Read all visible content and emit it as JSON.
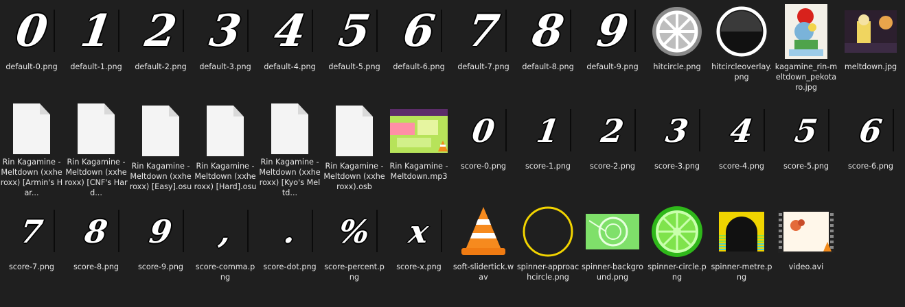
{
  "files": [
    {
      "label": "default-0.png",
      "kind": "digit",
      "glyph": "0"
    },
    {
      "label": "default-1.png",
      "kind": "digit",
      "glyph": "1"
    },
    {
      "label": "default-2.png",
      "kind": "digit",
      "glyph": "2"
    },
    {
      "label": "default-3.png",
      "kind": "digit",
      "glyph": "3"
    },
    {
      "label": "default-4.png",
      "kind": "digit",
      "glyph": "4"
    },
    {
      "label": "default-5.png",
      "kind": "digit",
      "glyph": "5"
    },
    {
      "label": "default-6.png",
      "kind": "digit",
      "glyph": "6"
    },
    {
      "label": "default-7.png",
      "kind": "digit",
      "glyph": "7"
    },
    {
      "label": "default-8.png",
      "kind": "digit",
      "glyph": "8"
    },
    {
      "label": "default-9.png",
      "kind": "digit",
      "glyph": "9"
    },
    {
      "label": "hitcircle.png",
      "kind": "hitcircle"
    },
    {
      "label": "hitcircleoverlay.png",
      "kind": "hitcircleoverlay"
    },
    {
      "label": "kagamine_rin-meltdown_pekotaro.jpg",
      "kind": "art-portrait"
    },
    {
      "label": "meltdown.jpg",
      "kind": "art-landscape"
    },
    {
      "label": "Rin Kagamine - Meltdown (xxheroxx) [Armin's Har...",
      "kind": "doc"
    },
    {
      "label": "Rin Kagamine - Meltdown (xxheroxx) [CNF's Hard...",
      "kind": "doc"
    },
    {
      "label": "Rin Kagamine - Meltdown (xxheroxx) [Easy].osu",
      "kind": "doc"
    },
    {
      "label": "Rin Kagamine - Meltdown (xxheroxx) [Hard].osu",
      "kind": "doc"
    },
    {
      "label": "Rin Kagamine - Meltdown (xxheroxx) [Kyo's Meltd...",
      "kind": "doc"
    },
    {
      "label": "Rin Kagamine - Meltdown (xxheroxx).osb",
      "kind": "doc"
    },
    {
      "label": "Rin Kagamine - Meltdown.mp3",
      "kind": "mp3"
    },
    {
      "label": "score-0.png",
      "kind": "digit-small",
      "glyph": "0"
    },
    {
      "label": "score-1.png",
      "kind": "digit-small",
      "glyph": "1"
    },
    {
      "label": "score-2.png",
      "kind": "digit-small",
      "glyph": "2"
    },
    {
      "label": "score-3.png",
      "kind": "digit-small",
      "glyph": "3"
    },
    {
      "label": "score-4.png",
      "kind": "digit-small",
      "glyph": "4"
    },
    {
      "label": "score-5.png",
      "kind": "digit-small",
      "glyph": "5"
    },
    {
      "label": "score-6.png",
      "kind": "digit-small",
      "glyph": "6"
    },
    {
      "label": "score-7.png",
      "kind": "digit-small",
      "glyph": "7"
    },
    {
      "label": "score-8.png",
      "kind": "digit-small",
      "glyph": "8"
    },
    {
      "label": "score-9.png",
      "kind": "digit-small",
      "glyph": "9"
    },
    {
      "label": "score-comma.png",
      "kind": "digit-small",
      "glyph": ","
    },
    {
      "label": "score-dot.png",
      "kind": "digit-small",
      "glyph": "."
    },
    {
      "label": "score-percent.png",
      "kind": "digit-small",
      "glyph": "%"
    },
    {
      "label": "score-x.png",
      "kind": "digit-small",
      "glyph": "x"
    },
    {
      "label": "soft-slidertick.wav",
      "kind": "vlc"
    },
    {
      "label": "spinner-approachcircle.png",
      "kind": "approach"
    },
    {
      "label": "spinner-background.png",
      "kind": "spin-bg"
    },
    {
      "label": "spinner-circle.png",
      "kind": "spin-circle"
    },
    {
      "label": "spinner-metre.png",
      "kind": "metre"
    },
    {
      "label": "video.avi",
      "kind": "video"
    }
  ]
}
